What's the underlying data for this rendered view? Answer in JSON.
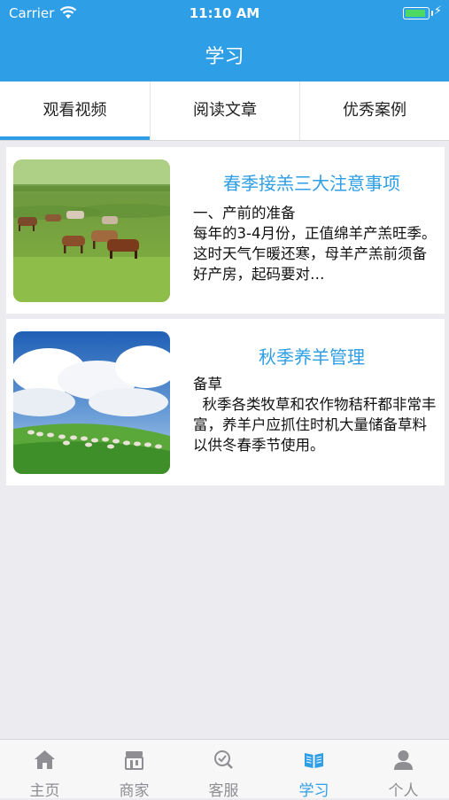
{
  "status_bar": {
    "carrier": "Carrier",
    "time": "11:10 AM",
    "battery_level": 1.0
  },
  "nav": {
    "title": "学习"
  },
  "tabs": [
    {
      "label": "观看视频",
      "selected": true
    },
    {
      "label": "阅读文章",
      "selected": false
    },
    {
      "label": "优秀案例",
      "selected": false
    }
  ],
  "articles": [
    {
      "title": "春季接羔三大注意事项",
      "line1": "一、产前的准备",
      "body": "每年的3-4月份，正值绵羊产羔旺季。这时天气乍暖还寒，母羊产羔前须备好产房，起码要对…",
      "image": "cows-grazing-on-grassland"
    },
    {
      "title": "秋季养羊管理",
      "line1": "备草",
      "body": "  秋季各类牧草和农作物秸秆都非常丰富，养羊户应抓住时机大量储备草料以供冬春季节使用。",
      "image": "sheep-flock-under-cloudy-sky"
    }
  ],
  "tabbar": {
    "active_color": "#2e9ee6",
    "items": [
      {
        "label": "主页",
        "icon": "home-icon",
        "active": false
      },
      {
        "label": "商家",
        "icon": "store-icon",
        "active": false
      },
      {
        "label": "客服",
        "icon": "service-icon",
        "active": false
      },
      {
        "label": "学习",
        "icon": "book-icon",
        "active": true
      },
      {
        "label": "个人",
        "icon": "person-icon",
        "active": false
      }
    ]
  },
  "colors": {
    "accent": "#2e9ee6",
    "background": "#ebebf0"
  }
}
